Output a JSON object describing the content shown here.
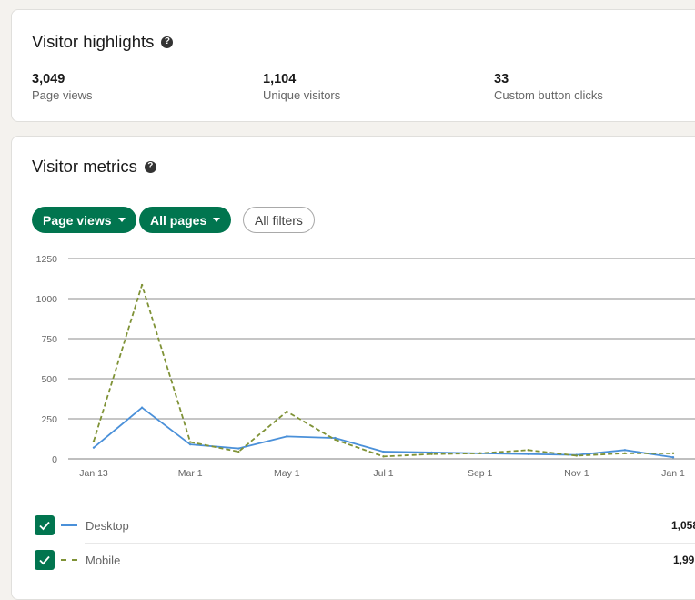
{
  "highlights": {
    "title": "Visitor highlights",
    "help_icon": "?",
    "stats": [
      {
        "value": "3,049",
        "label": "Page views"
      },
      {
        "value": "1,104",
        "label": "Unique visitors"
      },
      {
        "value": "33",
        "label": "Custom button clicks"
      }
    ]
  },
  "metrics": {
    "title": "Visitor metrics",
    "help_icon": "?",
    "filters": {
      "metric_label": "Page views",
      "pages_label": "All pages",
      "all_filters_label": "All filters"
    },
    "legend": [
      {
        "label": "Desktop",
        "total": "1,058",
        "checked": true,
        "color": "#4a90d9",
        "style": "solid"
      },
      {
        "label": "Mobile",
        "total": "1,99",
        "checked": true,
        "color": "#7f9236",
        "style": "dashed"
      }
    ]
  },
  "colors": {
    "accent_green": "#01754f",
    "desktop_line": "#4a90d9",
    "mobile_line": "#7f9236"
  },
  "chart_data": {
    "type": "line",
    "title": "",
    "xlabel": "",
    "ylabel": "",
    "ylim": [
      0,
      1250
    ],
    "yticks": [
      0,
      250,
      500,
      750,
      1000,
      1250
    ],
    "x_tick_labels": [
      "Jan 13",
      "Mar 1",
      "May 1",
      "Jul 1",
      "Sep 1",
      "Nov 1",
      "Jan 1"
    ],
    "x": [
      "Jan 13",
      "Feb 11",
      "Mar 1",
      "Mar 31",
      "May 1",
      "May 31",
      "Jul 1",
      "Jul 31",
      "Sep 1",
      "Oct 1",
      "Nov 1",
      "Dec 1",
      "Jan 1"
    ],
    "grid": true,
    "series": [
      {
        "name": "Desktop",
        "values": [
          70,
          320,
          90,
          65,
          140,
          130,
          45,
          40,
          35,
          30,
          25,
          55,
          10
        ]
      },
      {
        "name": "Mobile",
        "values": [
          110,
          1085,
          105,
          45,
          295,
          120,
          15,
          30,
          35,
          55,
          20,
          35,
          35
        ]
      }
    ]
  }
}
